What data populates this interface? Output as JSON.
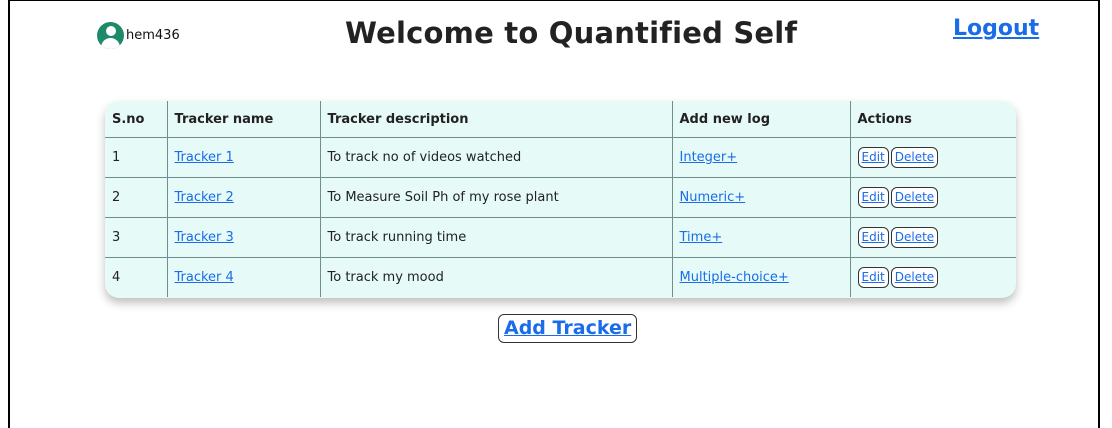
{
  "header": {
    "username": "hem436",
    "title": "Welcome to Quantified Self",
    "logout_label": "Logout"
  },
  "table": {
    "columns": [
      "S.no",
      "Tracker name",
      "Tracker description",
      "Add new log",
      "Actions"
    ],
    "rows": [
      {
        "sno": "1",
        "name": "Tracker 1",
        "description": "To track no of videos watched",
        "log": "Integer+",
        "edit": "Edit",
        "delete": "Delete"
      },
      {
        "sno": "2",
        "name": "Tracker 2",
        "description": "To Measure Soil Ph of my rose plant",
        "log": "Numeric+",
        "edit": "Edit",
        "delete": "Delete"
      },
      {
        "sno": "3",
        "name": "Tracker 3",
        "description": "To track running time",
        "log": "Time+",
        "edit": "Edit",
        "delete": "Delete"
      },
      {
        "sno": "4",
        "name": "Tracker 4",
        "description": "To track my mood",
        "log": "Multiple-choice+",
        "edit": "Edit",
        "delete": "Delete"
      }
    ]
  },
  "add_tracker_label": "Add Tracker",
  "colors": {
    "accent": "#1a6ce8",
    "table_bg": "#e6fbf8",
    "avatar": "#1e8a6a"
  },
  "icons": {
    "user": "user-icon"
  }
}
